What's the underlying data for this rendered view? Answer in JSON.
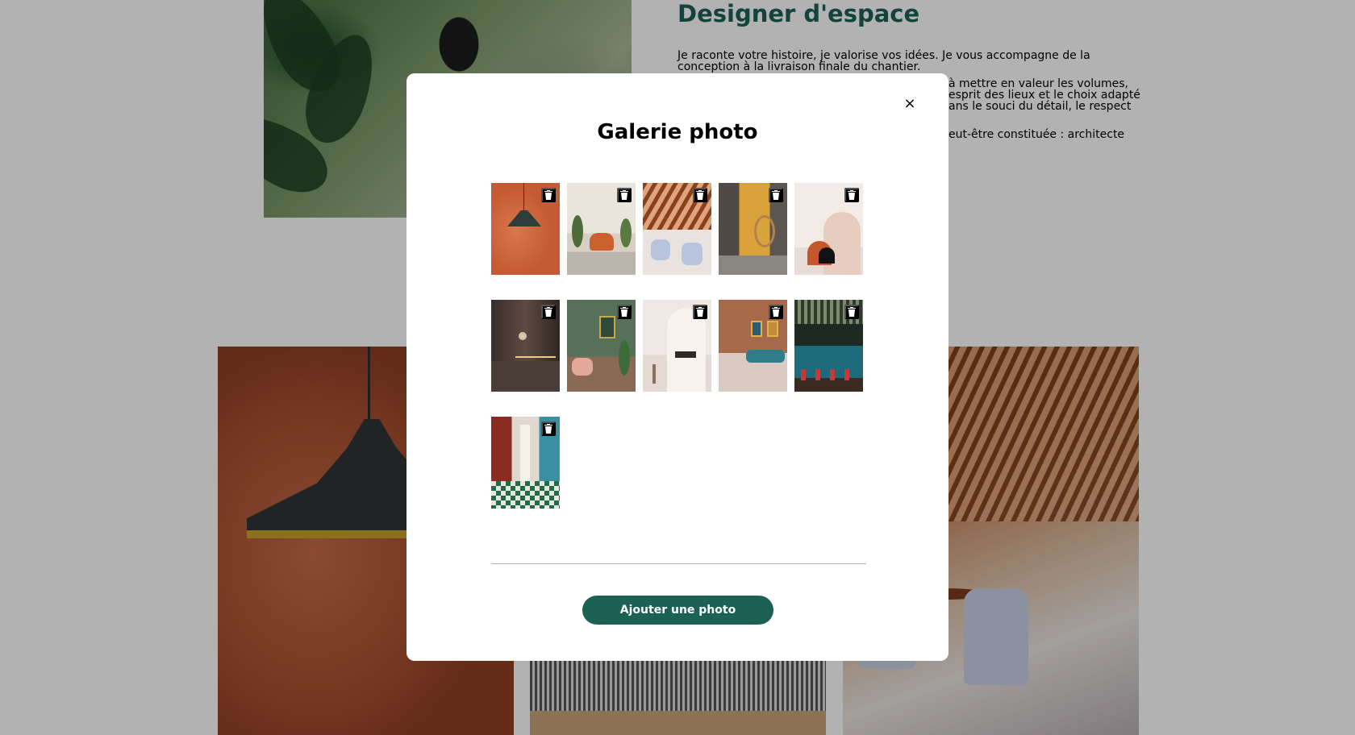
{
  "background": {
    "title": "Designer d'espace",
    "paragraphs": [
      "Je raconte votre histoire, je valorise vos idées. Je vous accompagne de la conception à la livraison finale du chantier.",
      "à mettre en valeur les volumes, esprit des lieux et le choix adapté ans le souci du détail, le respect",
      "eut-être constituée : architecte"
    ]
  },
  "modal": {
    "title": "Galerie photo",
    "close_label": "×",
    "photos": [
      {
        "subject": "orange wall with green pendant lamp"
      },
      {
        "subject": "living room with orange armchair and plants"
      },
      {
        "subject": "cafe with wooden roof and blue chairs"
      },
      {
        "subject": "room with rattan hanging chair"
      },
      {
        "subject": "pink arches with black semicircle"
      },
      {
        "subject": "dark kitchen with wall lamp"
      },
      {
        "subject": "green room with pink armchair"
      },
      {
        "subject": "white arch with small table"
      },
      {
        "subject": "terracotta room with blue sofa"
      },
      {
        "subject": "bar with blue counter and red stools"
      },
      {
        "subject": "restaurant corridor with checkered floor"
      }
    ],
    "add_button_label": "Ajouter une photo"
  },
  "colors": {
    "accent": "#1d6154",
    "overlay": "rgba(0,0,0,0.30)",
    "modal_bg": "#ffffff"
  }
}
